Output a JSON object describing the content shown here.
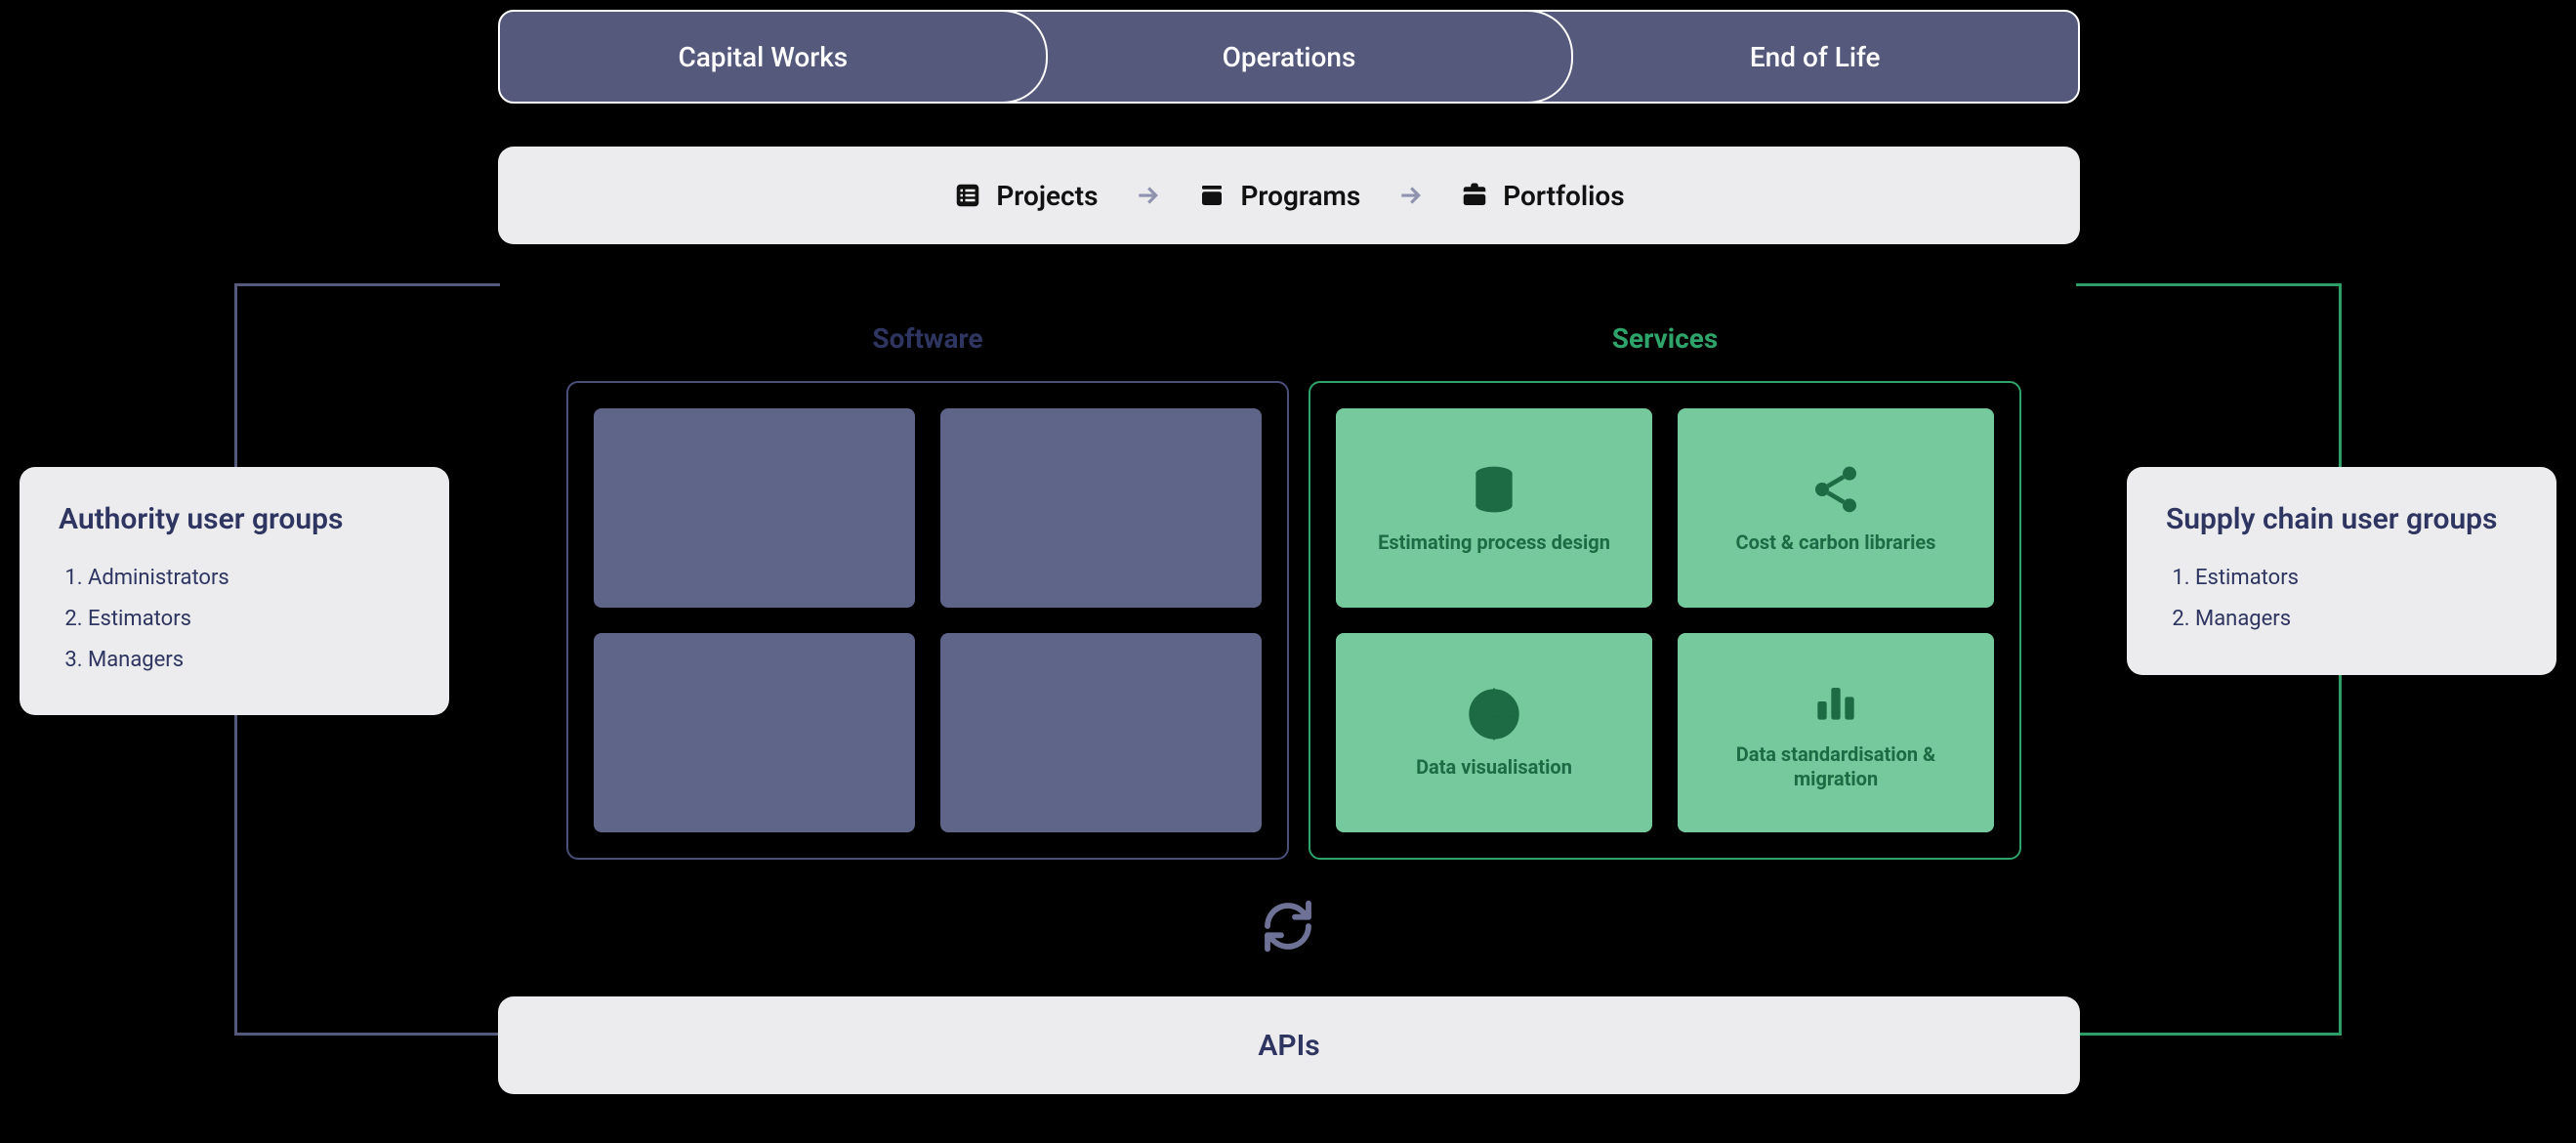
{
  "phases": {
    "p1": "Capital Works",
    "p2": "Operations",
    "p3": "End of Life"
  },
  "crumbs": {
    "c1": "Projects",
    "c2": "Programs",
    "c3": "Portfolios"
  },
  "sections": {
    "software_title": "Software",
    "services_title": "Services",
    "services": {
      "s1": "Estimating process design",
      "s2": "Cost & carbon libraries",
      "s3": "Data visualisation",
      "s4": "Data standardisation & migration"
    }
  },
  "left_panel": {
    "title": "Authority user groups",
    "items": {
      "i1": "Administrators",
      "i2": "Estimators",
      "i3": "Managers"
    }
  },
  "right_panel": {
    "title": "Supply chain user groups",
    "items": {
      "i1": "Estimators",
      "i2": "Managers"
    }
  },
  "apis": "APIs"
}
